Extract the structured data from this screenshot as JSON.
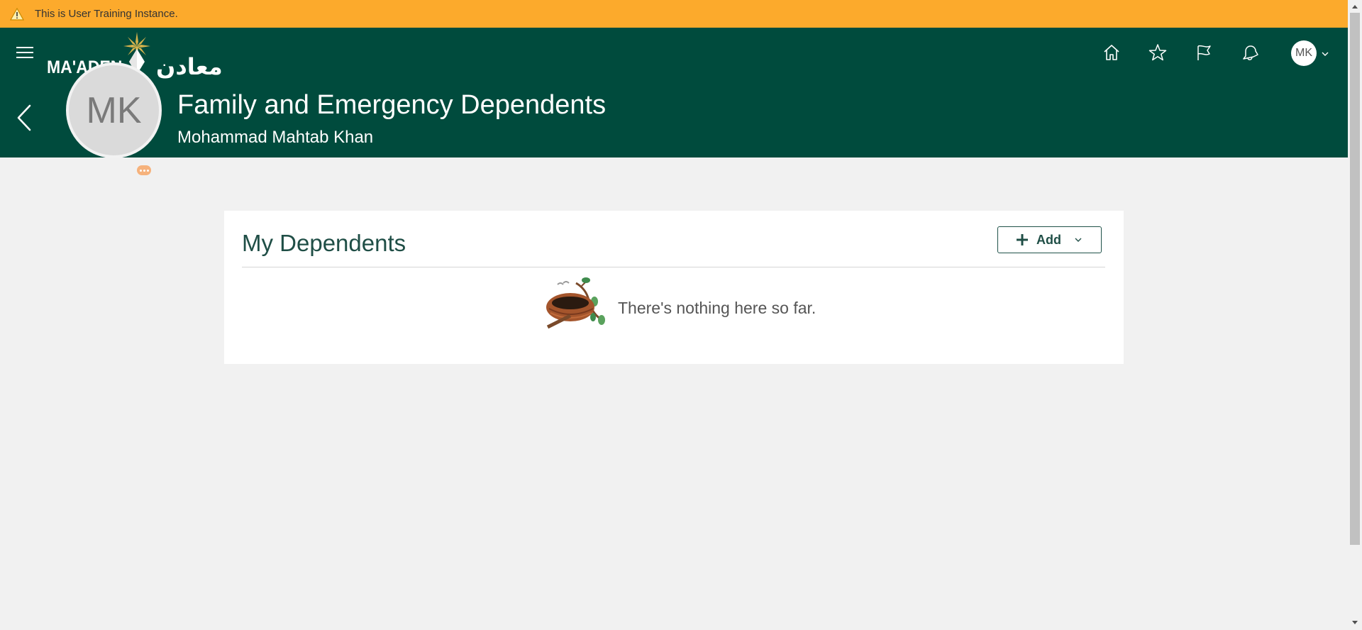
{
  "banner": {
    "text": "This is User Training Instance.",
    "color": "#fcaa2c"
  },
  "header": {
    "logo_text": "MA'ADEN",
    "logo_arabic": "معادن",
    "title": "Family and Emergency Dependents",
    "subtitle": "Mohammad Mahtab Khan",
    "avatar_initials": "MK",
    "user_initials": "MK",
    "icons": [
      "home-icon",
      "star-icon",
      "flag-icon",
      "bell-icon"
    ],
    "color": "#004b3d"
  },
  "card": {
    "title": "My Dependents",
    "add_label": "Add",
    "empty_text": "There's nothing here so far."
  }
}
